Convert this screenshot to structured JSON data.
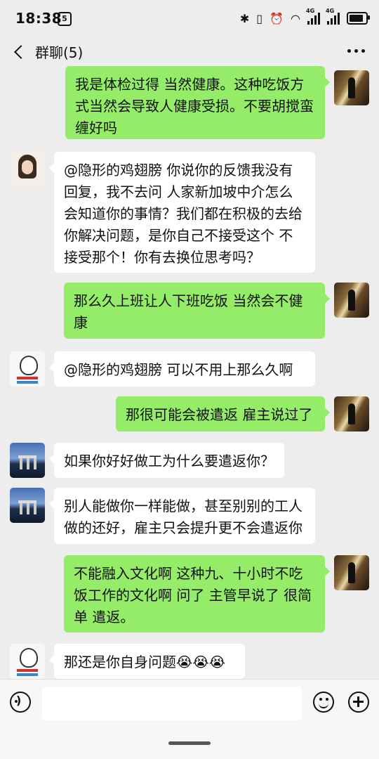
{
  "status": {
    "time": "18:38",
    "sim_label": "5",
    "sig1": "4G",
    "sig2": "4G"
  },
  "header": {
    "title": "群聊(5)",
    "back_icon": "chevron-left-icon",
    "more_icon": "more-dots-icon"
  },
  "messages": [
    {
      "side": "right",
      "avatar": "night-scene",
      "lines": [
        "我是体检过得 当然健康。这种吃饭方",
        "式当然会导致人健康受损。不要胡搅蛮",
        "缠好吗"
      ]
    },
    {
      "side": "left",
      "avatar": "woman-portrait",
      "lines": [
        "@隐形的鸡翅膀 你说你的反馈我没有",
        "回复，我不去问 人家新加坡中介怎么",
        "会知道你的事情？我们都在积极的去给",
        "你解决问题，是你自己不接受这个 不",
        "接受那个！你有去换位思考吗？"
      ]
    },
    {
      "side": "right",
      "avatar": "night-scene",
      "lines": [
        "那么久上班让人下班吃饭 当然会不健",
        "康"
      ]
    },
    {
      "side": "left",
      "avatar": "cartoon-meme",
      "lines": [
        "@隐形的鸡翅膀  可以不用上那么久啊"
      ]
    },
    {
      "side": "right",
      "avatar": "night-scene",
      "lines": [
        "那很可能会被遣返 雇主说过了"
      ]
    },
    {
      "side": "left",
      "avatar": "singapore-city",
      "lines": [
        "如果你好好做工为什么要遣返你？"
      ]
    },
    {
      "side": "left",
      "avatar": "singapore-city",
      "lines": [
        "别人能做你一样能做，甚至别别的工人",
        "做的还好，雇主只会提升更不会遣返你"
      ]
    },
    {
      "side": "right",
      "avatar": "night-scene",
      "lines": [
        "不能融入文化啊 这种九、十小时不吃",
        "饭工作的文化啊 问了 主管早说了 很简",
        "单 遣返。"
      ]
    },
    {
      "side": "left",
      "avatar": "cartoon-meme",
      "lines": [
        "那还是你自身问题😭😭😭"
      ]
    }
  ],
  "input": {
    "placeholder": "",
    "voice_icon": "voice-icon",
    "emoji_icon": "emoji-icon",
    "plus_icon": "plus-icon"
  }
}
